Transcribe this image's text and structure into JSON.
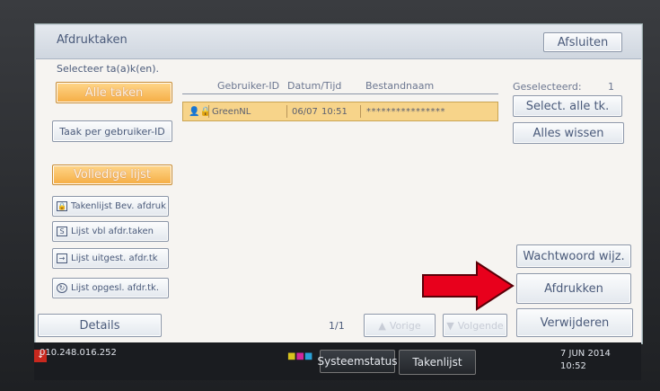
{
  "window": {
    "title": "Afdruktaken",
    "close_label": "Afsluiten"
  },
  "prompt": "Selecteer ta(a)k(en).",
  "left_buttons": {
    "all_jobs": "Alle taken",
    "per_user": "Taak per gebruiker-ID",
    "full_list": "Volledige lijst",
    "secure_print": "Takenlijst Bev. afdruk",
    "hold_print": "Lijst vbl afdr.taken",
    "delayed_print": "Lijst uitgest. afdr.tk",
    "stored_print": "Lijst opgesl. afdr.tk.",
    "details": "Details"
  },
  "table": {
    "headers": [
      "Gebruiker-ID",
      "Datum/Tijd",
      "Bestandnaam"
    ],
    "rows": [
      {
        "user": "GreenNL",
        "date": "06/07",
        "time": "10:51",
        "filename": "****************"
      }
    ]
  },
  "right_panel": {
    "selected_label": "Geselecteerd:",
    "selected_count": "1",
    "select_all": "Select. alle tk.",
    "clear_all": "Alles wissen",
    "change_password": "Wachtwoord wijz.",
    "print": "Afdrukken",
    "delete": "Verwijderen"
  },
  "pagination": {
    "page": "1/1",
    "prev": "Vorige",
    "next": "Volgende"
  },
  "status": {
    "ip": "010.248.016.252",
    "system_status": "Systeemstatus",
    "job_list": "Takenlijst",
    "date": "7 JUN 2014",
    "time": "10:52"
  },
  "colors": {
    "accent": "#f5ad44",
    "arrow": "#e8001c"
  }
}
